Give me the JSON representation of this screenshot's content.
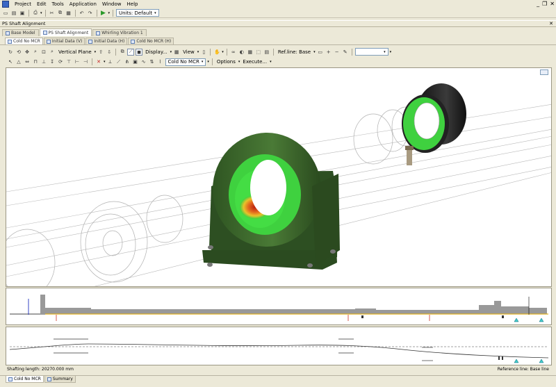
{
  "menubar": {
    "items": [
      {
        "label": "Project"
      },
      {
        "label": "Edit"
      },
      {
        "label": "Tools"
      },
      {
        "label": "Application"
      },
      {
        "label": "Window"
      },
      {
        "label": "Help"
      }
    ]
  },
  "toolbar_main": {
    "units_combo": "Units: Default"
  },
  "panel_title": "PS Shaft Alignment",
  "doc_tabs": [
    {
      "label": "Base Model"
    },
    {
      "label": "PS Shaft Alignment"
    },
    {
      "label": "Whirling Vibration 1"
    }
  ],
  "view_tabs": [
    {
      "label": "Cold No MCR"
    },
    {
      "label": "Initial Data (V)"
    },
    {
      "label": "Initial Data (H)"
    },
    {
      "label": "Cold No MCR (H)"
    }
  ],
  "toolbar_view": {
    "plane_label": "Vertical Plane",
    "display_label": "Display...",
    "view_label": "View",
    "refline_label": "Ref.line: Base"
  },
  "toolbar_edit": {
    "condition_combo": "Cold No MCR",
    "options_label": "Options",
    "execute_label": "Execute..."
  },
  "status": {
    "shafting_length": "Shafting length: 20270.000 mm",
    "reference_line": "Reference line: Base line"
  },
  "bottom_tabs": [
    {
      "label": "Cold No MCR"
    },
    {
      "label": "Summary"
    }
  ],
  "colors": {
    "bearing_body": "#3f6a2f",
    "bearing_liner": "#3fd13f",
    "hot_spot": "#d24a1a",
    "accent": "#3a66c4"
  }
}
